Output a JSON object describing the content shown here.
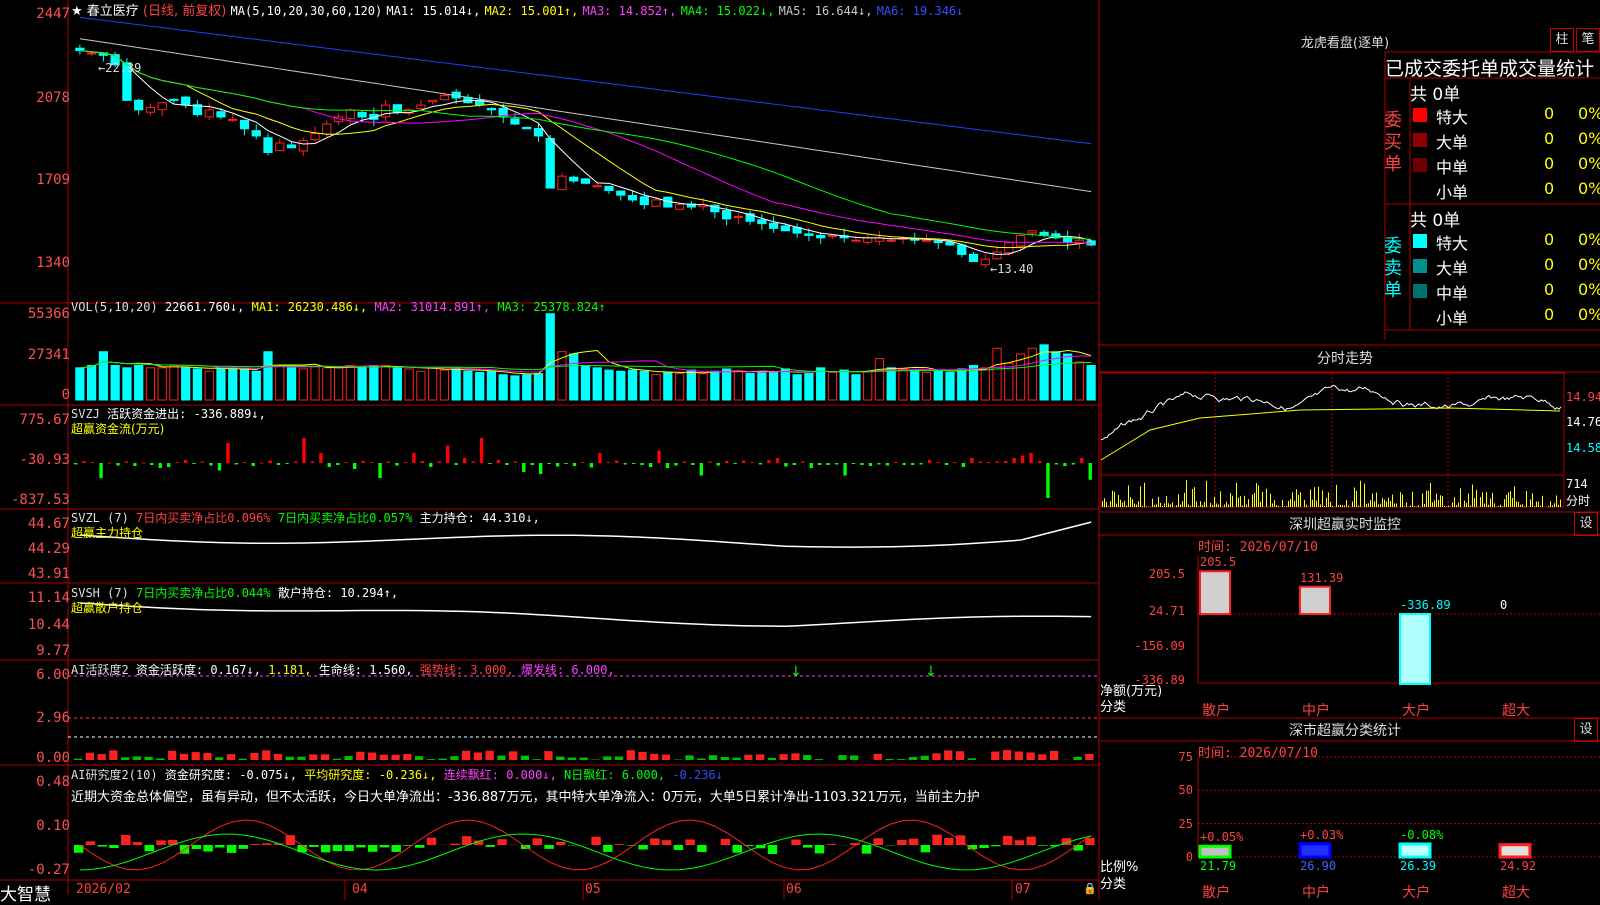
{
  "colors": {
    "grid": "#b00000",
    "up": "#ff2020",
    "down": "#00ffff",
    "ma1": "#ffffff",
    "ma2": "#ffff00",
    "ma3": "#ff00ff",
    "ma4": "#00ff00",
    "ma5": "#c8c8c8",
    "ma6": "#2040ff",
    "text_red": "#ff4040",
    "text_green": "#00ff00",
    "text_yellow": "#ffff00",
    "text_magenta": "#ff40ff"
  },
  "app": {
    "brand": "大智慧"
  },
  "kline": {
    "stock_name": "春立医疗",
    "period_tag": "(日线, 前复权)",
    "ma_def": "MA(5,10,20,30,60,120)",
    "ma": [
      {
        "label": "MA1: 15.014↓,",
        "color": "#ffffff"
      },
      {
        "label": "MA2: 15.001↑,",
        "color": "#ffff00"
      },
      {
        "label": "MA3: 14.852↑,",
        "color": "#ff00ff"
      },
      {
        "label": "MA4: 15.022↓,",
        "color": "#00ff00"
      },
      {
        "label": "MA5: 16.644↓,",
        "color": "#c8c8c8"
      },
      {
        "label": "MA6: 19.346↓",
        "color": "#3050ff"
      }
    ],
    "yticks": [
      "2447",
      "2078",
      "1709",
      "1340"
    ],
    "high_label": "←22.39",
    "low_label": "←13.40",
    "closes": [
      23.1,
      23.0,
      22.9,
      22.5,
      21.0,
      20.6,
      20.7,
      20.9,
      21.0,
      20.8,
      20.4,
      20.6,
      20.3,
      20.2,
      19.8,
      19.5,
      18.8,
      19.2,
      19.0,
      19.3,
      19.6,
      20.0,
      20.3,
      20.6,
      20.3,
      20.2,
      20.8,
      20.5,
      20.6,
      20.8,
      21.0,
      21.2,
      21.1,
      20.9,
      20.8,
      20.6,
      20.3,
      20.0,
      19.8,
      19.5,
      17.3,
      17.8,
      17.6,
      17.5,
      17.4,
      17.2,
      17.0,
      16.8,
      16.6,
      16.8,
      16.5,
      16.6,
      16.5,
      16.6,
      16.3,
      16.0,
      16.1,
      15.9,
      15.8,
      15.6,
      15.5,
      15.4,
      15.3,
      15.2,
      15.3,
      15.2,
      15.1,
      15.2,
      15.2,
      15.1,
      15.2,
      15.1,
      15.1,
      15.0,
      14.9,
      14.5,
      14.2,
      14.3,
      14.6,
      15.0,
      15.3,
      15.5,
      15.3,
      15.2,
      15.0,
      15.1,
      14.9
    ]
  },
  "vol": {
    "label": "VOL(5,10,20)",
    "value": "22661.760↓,",
    "ma1": "MA1: 26230.486↓,",
    "ma2": "MA2: 31014.891↑,",
    "ma3": "MA3: 25378.824↑",
    "yticks": [
      "55366",
      "27341",
      "0"
    ],
    "values": [
      28,
      30,
      42,
      30,
      28,
      30,
      28,
      28,
      30,
      28,
      27,
      25,
      28,
      28,
      27,
      25,
      42,
      30,
      28,
      27,
      29,
      28,
      28,
      30,
      28,
      30,
      30,
      28,
      27,
      25,
      28,
      26,
      27,
      25,
      24,
      25,
      22,
      21,
      22,
      23,
      75,
      42,
      40,
      30,
      28,
      26,
      25,
      26,
      25,
      22,
      24,
      23,
      26,
      23,
      25,
      27,
      25,
      23,
      25,
      24,
      27,
      22,
      23,
      28,
      24,
      26,
      22,
      25,
      36,
      28,
      27,
      26,
      24,
      25,
      24,
      27,
      30,
      28,
      45,
      32,
      40,
      45,
      48,
      42,
      40,
      33,
      30
    ]
  },
  "svzj": {
    "label": "SVZJ",
    "value": "活跃资金进出: -336.889↓,",
    "sublabel": "超赢资金流(万元)",
    "yticks": [
      "775.67",
      "-30.93",
      "-837.53"
    ],
    "values": [
      -30,
      40,
      20,
      -300,
      10,
      -50,
      30,
      -60,
      10,
      -40,
      -100,
      -80,
      20,
      60,
      -10,
      30,
      -50,
      -150,
      400,
      -30,
      20,
      -60,
      10,
      50,
      -40,
      -20,
      30,
      500,
      30,
      200,
      -80,
      -40,
      20,
      -120,
      40,
      20,
      -300,
      30,
      -50,
      20,
      200,
      40,
      -80,
      30,
      350,
      -40,
      100,
      30,
      500,
      -20,
      60,
      -40,
      30,
      -180,
      -40,
      -220,
      -20,
      -70,
      -10,
      -60,
      20,
      -90,
      200,
      20,
      50,
      -30,
      -20,
      -40,
      -80,
      250,
      -100,
      -50,
      30,
      -40,
      -250,
      30,
      -50,
      40,
      -20,
      50,
      20,
      -30,
      60,
      100,
      -70,
      -40,
      30,
      -100,
      -40,
      -40,
      -30,
      -250,
      -20,
      -40,
      -60,
      -30,
      -50,
      20,
      -40,
      -40,
      -30,
      60,
      20,
      -40,
      20,
      -80,
      100,
      30,
      20,
      30,
      40,
      100,
      150,
      200,
      40,
      -700,
      -30,
      -60,
      -30,
      100,
      -336
    ]
  },
  "svzl": {
    "label": "SVZL (7)",
    "text1": "7日内买卖净占比0.096%",
    "text2": "7日内买卖净占比0.057%",
    "text3": "主力持仓: 44.310↓,",
    "sublabel": "超赢主力持仓",
    "yticks": [
      "44.67",
      "44.29",
      "43.91"
    ]
  },
  "svsh": {
    "label": "SVSH (7)",
    "text1": "7日内买卖净占比0.044%",
    "text2": "散户持仓: 10.294↑,",
    "sublabel": "超赢散户持仓",
    "yticks": [
      "11.14",
      "10.44",
      "9.77"
    ]
  },
  "ai1": {
    "label": "AI活跃度2",
    "text1": "资金活跃度: 0.167↓,",
    "text2": "1.181,",
    "text3": "生命线: 1.560,",
    "text4": "强势线: 3.000,",
    "text5": "爆发线: 6.000,",
    "yticks": [
      "6.00",
      "2.96",
      "0.00"
    ]
  },
  "ai2": {
    "label": "AI研究度2(10)",
    "text1": "资金研究度: -0.075↓,",
    "text2": "平均研究度: -0.236↓,",
    "text3": "连续飘红: 0.000↓,",
    "text4": "N日飘红: 6.000,",
    "text5": "-0.236↓",
    "summary": "近期大资金总体偏空，虽有异动，但不太活跃，今日大单净流出：-336.887万元，其中特大单净流入：0万元，大单5日累计净出-1103.321万元，当前主力护",
    "yticks": [
      "0.48",
      "0.10",
      "-0.27"
    ]
  },
  "xaxis": [
    "2026/02",
    "04",
    "05",
    "06",
    "07"
  ],
  "longhu": {
    "title": "龙虎看盘(逐单)",
    "btn1": "柱",
    "btn2": "笔",
    "header": "已成交委托单成交量统计",
    "buy_label": "委买单",
    "sell_label": "委卖单",
    "buy_total": "共 0单",
    "sell_total": "共 0单",
    "buy_rows": [
      {
        "name": "特大",
        "v": "0",
        "p": "0%",
        "c": "#ff0000"
      },
      {
        "name": "大单",
        "v": "0",
        "p": "0%",
        "c": "#900000"
      },
      {
        "name": "中单",
        "v": "0",
        "p": "0%",
        "c": "#700000"
      },
      {
        "name": "小单",
        "v": "0",
        "p": "0%",
        "c": ""
      }
    ],
    "sell_rows": [
      {
        "name": "特大",
        "v": "0",
        "p": "0%",
        "c": "#00ffff"
      },
      {
        "name": "大单",
        "v": "0",
        "p": "0%",
        "c": "#009090"
      },
      {
        "name": "中单",
        "v": "0",
        "p": "0%",
        "c": "#007070"
      },
      {
        "name": "小单",
        "v": "0",
        "p": "0%",
        "c": ""
      }
    ]
  },
  "intraday": {
    "title": "分时走势",
    "yticks": [
      "14.94",
      "14.76",
      "14.58"
    ],
    "vol_tick": "714",
    "vol_unit": "分时"
  },
  "monitor": {
    "title": "深圳超赢实时监控",
    "btn": "设",
    "time": "时间: 2026/07/10",
    "yticks": [
      "205.5",
      "24.71",
      "-156.09",
      "-336.89"
    ],
    "ylabel1": "净额(万元)",
    "ylabel2": "分类",
    "categories": [
      "散户",
      "中户",
      "大户",
      "超大"
    ],
    "values": [
      205.5,
      131.39,
      -336.89,
      0
    ],
    "value_labels": [
      "205.5",
      "131.39",
      "-336.89",
      "0"
    ]
  },
  "classify": {
    "title": "深市超赢分类统计",
    "btn": "设",
    "time": "时间: 2026/07/10",
    "yticks": [
      "75",
      "50",
      "25",
      "0"
    ],
    "ylabel1": "比例%",
    "ylabel2": "分类",
    "categories": [
      "散户",
      "中户",
      "大户",
      "超大"
    ],
    "values": [
      21.79,
      26.9,
      26.39,
      24.92
    ],
    "change": [
      "+0.05%",
      "+0.03%",
      "-0.08%",
      ""
    ],
    "value_labels": [
      "21.79",
      "26.90",
      "26.39",
      "24.92"
    ]
  }
}
